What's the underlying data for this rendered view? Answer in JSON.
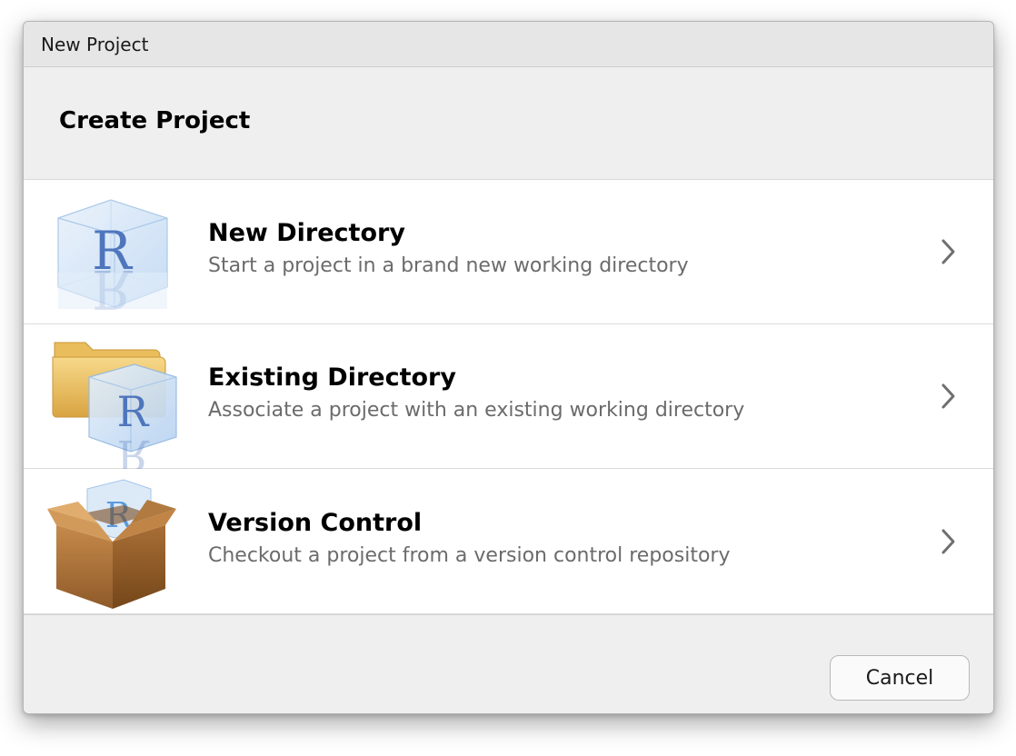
{
  "window": {
    "title": "New Project"
  },
  "header": {
    "title": "Create Project"
  },
  "options": [
    {
      "title": "New Directory",
      "description": "Start a project in a brand new working directory",
      "icon": "r-cube-icon"
    },
    {
      "title": "Existing Directory",
      "description": "Associate a project with an existing working directory",
      "icon": "folder-r-cube-icon"
    },
    {
      "title": "Version Control",
      "description": "Checkout a project from a version control repository",
      "icon": "box-r-icon"
    }
  ],
  "footer": {
    "cancel_label": "Cancel"
  },
  "icon_letter": "R",
  "colors": {
    "r_blue": "#5b7fbf",
    "folder": "#e6b54e",
    "box": "#b07a3f"
  }
}
